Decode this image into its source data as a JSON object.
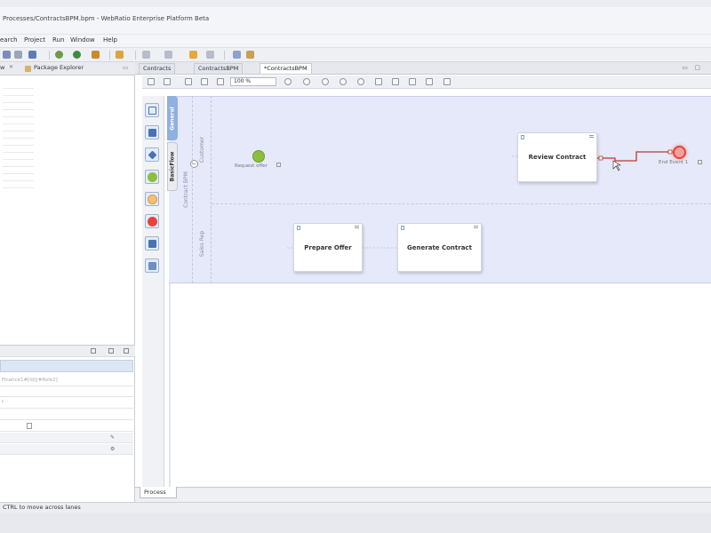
{
  "window": {
    "title": "Processes/ContractsBPM.bpm - WebRatio Enterprise Platform Beta"
  },
  "menu": [
    "earch",
    "Project",
    "Run",
    "Window",
    "Help"
  ],
  "left_panel": {
    "tabs": [
      "w",
      "Package Explorer"
    ],
    "properties_rows": [
      "Finance1#[Id][#Role2]",
      "t"
    ]
  },
  "editor": {
    "tabs": [
      "Contracts",
      "ContractsBPM",
      "*ContractsBPM"
    ],
    "zoom": "100 %",
    "side_tabs": {
      "general": "General",
      "basic": "BasicFlow"
    },
    "pool_label": "Contract BPM",
    "lanes": [
      "Customer",
      "Sales Rep"
    ],
    "bottom_tab": "Process"
  },
  "diagram": {
    "start_event": {
      "label": "Request offer"
    },
    "end_event": {
      "label": "End Event 1"
    },
    "tasks": {
      "review": "Review Contract",
      "prepare": "Prepare Offer",
      "generate": "Generate Contract"
    },
    "colors": {
      "start": "#8cbf3f",
      "end": "#e8433a",
      "flow": "#c0392b",
      "pool": "#e5e9f9",
      "accent_tab": "#8fb0e0"
    }
  },
  "status": {
    "hint": "CTRL to move across lanes"
  }
}
